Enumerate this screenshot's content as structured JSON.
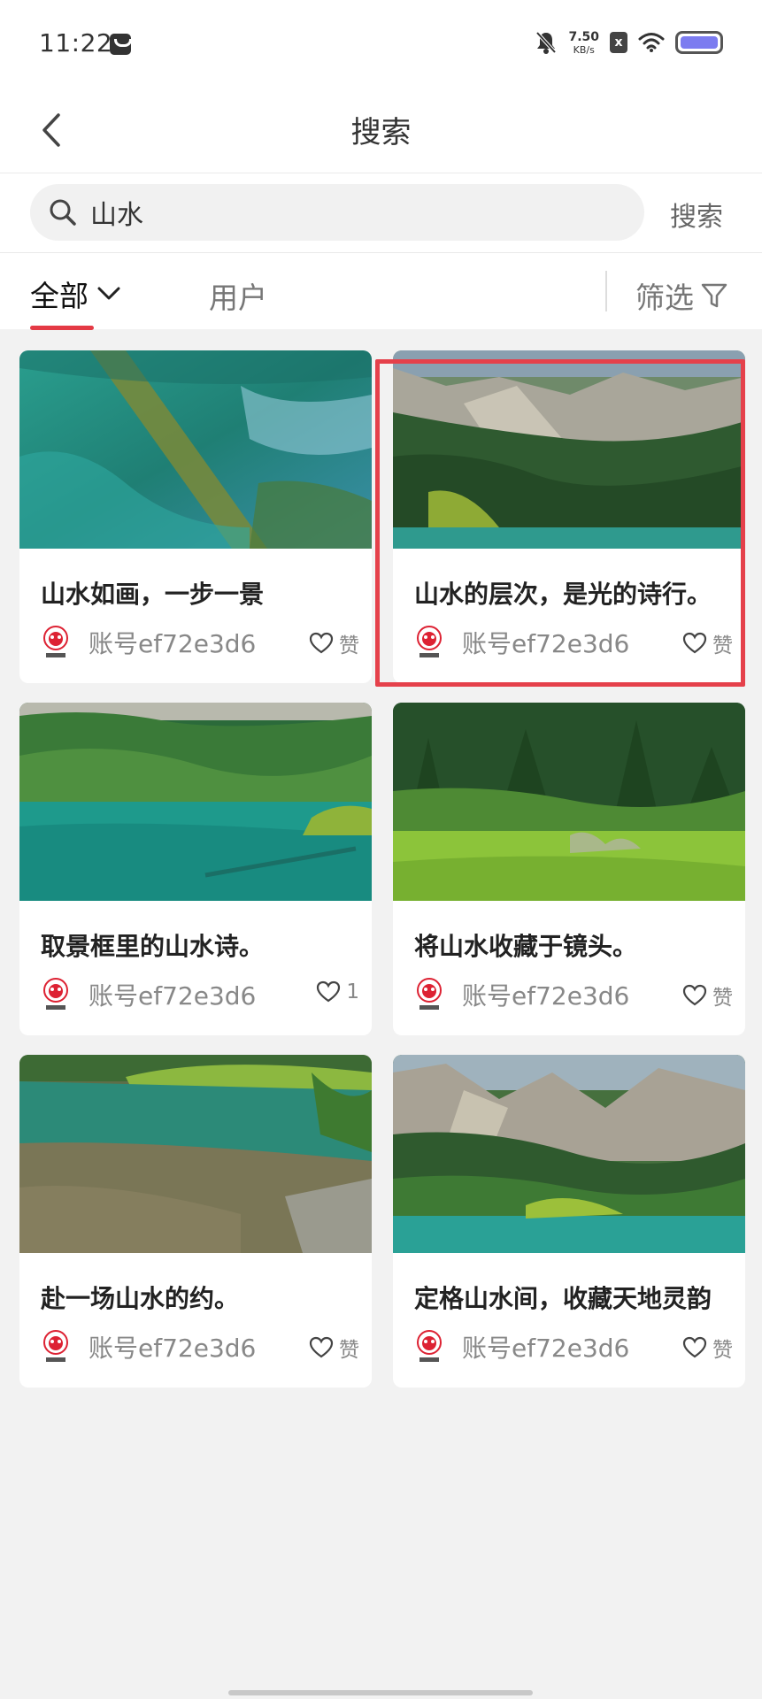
{
  "status": {
    "time": "11:22",
    "net_speed_value": "7.50",
    "net_speed_unit": "KB/s",
    "sim_label": "x"
  },
  "nav": {
    "title": "搜索"
  },
  "search": {
    "query": "山水",
    "button_label": "搜索"
  },
  "tabs": {
    "all_label": "全部",
    "user_label": "用户",
    "filter_label": "筛选"
  },
  "colors": {
    "accent": "#e43a45",
    "highlight_border": "#e5414b"
  },
  "cards": [
    {
      "title": "山水如画，一步一景",
      "author": "账号ef72e3d6",
      "likes": "赞",
      "image": "clear-lake-log-underwater"
    },
    {
      "title": "山水的层次，是光的诗行。",
      "author": "账号ef72e3d6",
      "likes": "赞",
      "image": "forest-mountain-lake"
    },
    {
      "title": "取景框里的山水诗。",
      "author": "账号ef72e3d6",
      "likes": "1",
      "image": "turquoise-lake-forest"
    },
    {
      "title": "将山水收藏于镜头。",
      "author": "账号ef72e3d6",
      "likes": "赞",
      "image": "green-meadow-forest"
    },
    {
      "title": "赴一场山水的约。",
      "author": "账号ef72e3d6",
      "likes": "赞",
      "image": "shallow-lake-shore"
    },
    {
      "title": "定格山水间，收藏天地灵韵",
      "author": "账号ef72e3d6",
      "likes": "赞",
      "image": "mountain-valley-lake"
    }
  ]
}
